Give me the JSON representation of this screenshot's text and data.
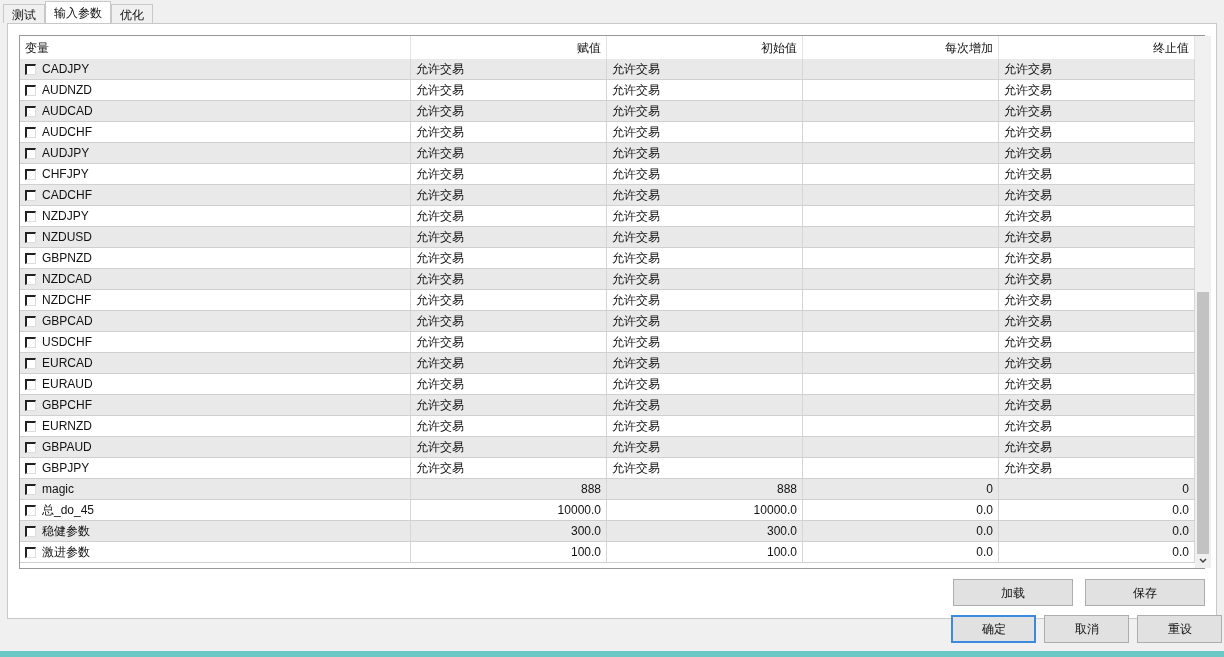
{
  "tabs": [
    {
      "label": "测试",
      "selected": false
    },
    {
      "label": "输入参数",
      "selected": true
    },
    {
      "label": "优化",
      "selected": false
    }
  ],
  "table": {
    "columns": [
      "变量",
      "赋值",
      "初始值",
      "每次增加",
      "终止值"
    ],
    "rows": [
      {
        "checked": false,
        "name": "CADJPY",
        "value": "允许交易",
        "start": "允许交易",
        "stop": "允许交易"
      },
      {
        "checked": false,
        "name": "AUDNZD",
        "value": "允许交易",
        "start": "允许交易",
        "stop": "允许交易"
      },
      {
        "checked": false,
        "name": "AUDCAD",
        "value": "允许交易",
        "start": "允许交易",
        "stop": "允许交易"
      },
      {
        "checked": false,
        "name": "AUDCHF",
        "value": "允许交易",
        "start": "允许交易",
        "stop": "允许交易"
      },
      {
        "checked": false,
        "name": "AUDJPY",
        "value": "允许交易",
        "start": "允许交易",
        "stop": "允许交易"
      },
      {
        "checked": false,
        "name": "CHFJPY",
        "value": "允许交易",
        "start": "允许交易",
        "stop": "允许交易"
      },
      {
        "checked": false,
        "name": "CADCHF",
        "value": "允许交易",
        "start": "允许交易",
        "stop": "允许交易"
      },
      {
        "checked": false,
        "name": "NZDJPY",
        "value": "允许交易",
        "start": "允许交易",
        "stop": "允许交易"
      },
      {
        "checked": false,
        "name": "NZDUSD",
        "value": "允许交易",
        "start": "允许交易",
        "stop": "允许交易"
      },
      {
        "checked": false,
        "name": "GBPNZD",
        "value": "允许交易",
        "start": "允许交易",
        "stop": "允许交易"
      },
      {
        "checked": false,
        "name": "NZDCAD",
        "value": "允许交易",
        "start": "允许交易",
        "stop": "允许交易"
      },
      {
        "checked": false,
        "name": "NZDCHF",
        "value": "允许交易",
        "start": "允许交易",
        "stop": "允许交易"
      },
      {
        "checked": false,
        "name": "GBPCAD",
        "value": "允许交易",
        "start": "允许交易",
        "stop": "允许交易"
      },
      {
        "checked": false,
        "name": "USDCHF",
        "value": "允许交易",
        "start": "允许交易",
        "stop": "允许交易"
      },
      {
        "checked": false,
        "name": "EURCAD",
        "value": "允许交易",
        "start": "允许交易",
        "stop": "允许交易"
      },
      {
        "checked": false,
        "name": "EURAUD",
        "value": "允许交易",
        "start": "允许交易",
        "stop": "允许交易"
      },
      {
        "checked": false,
        "name": "GBPCHF",
        "value": "允许交易",
        "start": "允许交易",
        "stop": "允许交易"
      },
      {
        "checked": false,
        "name": "EURNZD",
        "value": "允许交易",
        "start": "允许交易",
        "stop": "允许交易"
      },
      {
        "checked": false,
        "name": "GBPAUD",
        "value": "允许交易",
        "start": "允许交易",
        "stop": "允许交易"
      },
      {
        "checked": false,
        "name": "GBPJPY",
        "value": "允许交易",
        "start": "允许交易",
        "stop": "允许交易"
      },
      {
        "checked": false,
        "name": "magic",
        "value": "888",
        "start": "888",
        "step": "0",
        "stop": "0",
        "numeric": true
      },
      {
        "checked": false,
        "name": "总_do_45",
        "value": "10000.0",
        "start": "10000.0",
        "step": "0.0",
        "stop": "0.0",
        "numeric": true
      },
      {
        "checked": false,
        "name": "稳健参数",
        "value": "300.0",
        "start": "300.0",
        "step": "0.0",
        "stop": "0.0",
        "numeric": true
      },
      {
        "checked": false,
        "name": "激进参数",
        "value": "100.0",
        "start": "100.0",
        "step": "0.0",
        "stop": "0.0",
        "numeric": true
      }
    ]
  },
  "side_buttons": [
    "加载",
    "保存"
  ],
  "dialog_buttons": [
    {
      "label": "确定",
      "focused": true
    },
    {
      "label": "取消",
      "focused": false
    },
    {
      "label": "重设",
      "focused": false
    }
  ]
}
